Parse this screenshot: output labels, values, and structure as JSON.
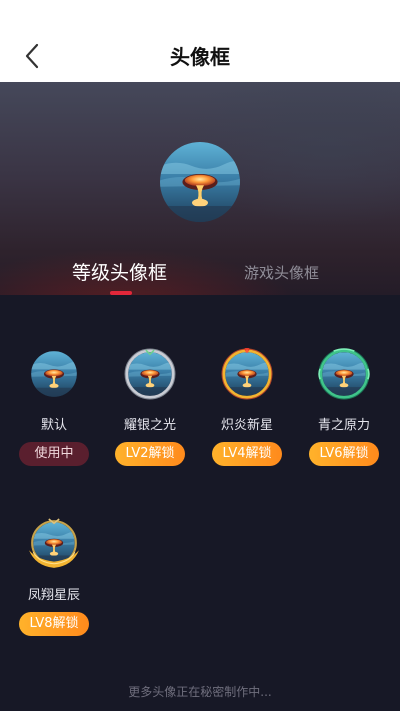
{
  "nav": {
    "title": "头像框"
  },
  "tabs": [
    {
      "label": "等级头像框",
      "active": true
    },
    {
      "label": "游戏头像框",
      "active": false
    }
  ],
  "frames": [
    {
      "name": "默认",
      "status": "使用中",
      "frame_style": "none"
    },
    {
      "name": "耀银之光",
      "status": "LV2解锁",
      "frame_style": "silver"
    },
    {
      "name": "炽炎新星",
      "status": "LV4解锁",
      "frame_style": "flame"
    },
    {
      "name": "青之原力",
      "status": "LV6解锁",
      "frame_style": "jade"
    },
    {
      "name": "凤翔星辰",
      "status": "LV8解锁",
      "frame_style": "phoenix"
    }
  ],
  "footer": {
    "note": "更多头像正在秘密制作中..."
  },
  "colors": {
    "accent": "#e2273a",
    "unlock_pill": "#ff9a22",
    "using_pill": "#5a1f2e",
    "background": "#171826"
  }
}
